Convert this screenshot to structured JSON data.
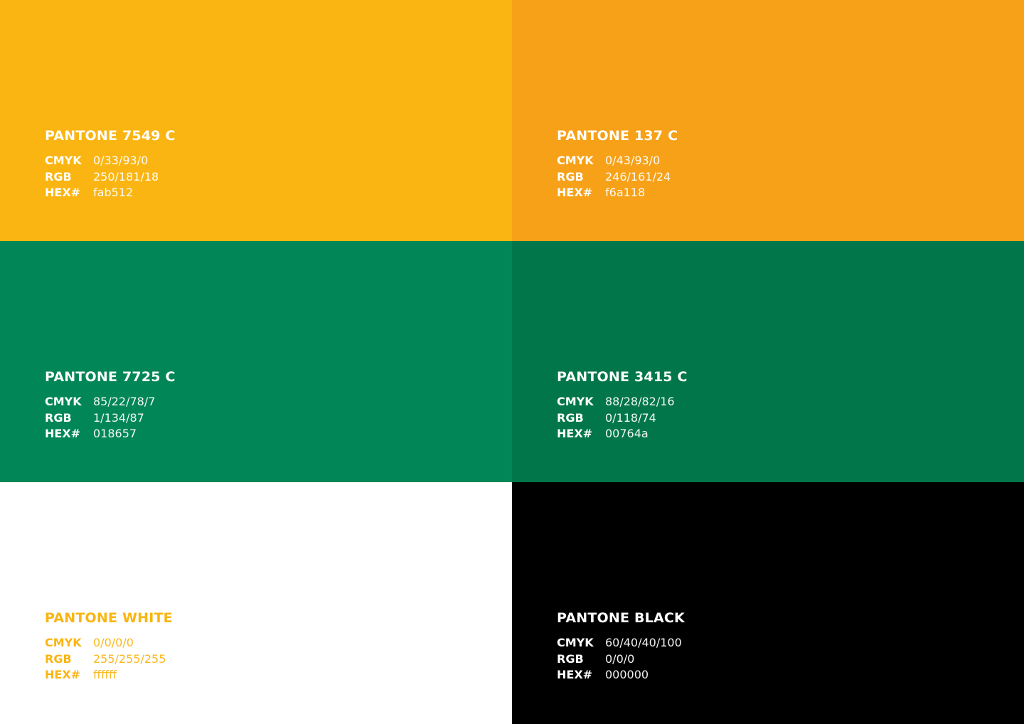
{
  "swatches": [
    {
      "name": "PANTONE 7549 C",
      "bg": "#fab512",
      "text_color": "#ffffff",
      "cmyk_label": "CMYK",
      "cmyk": "0/33/93/0",
      "rgb_label": "RGB",
      "rgb": "250/181/18",
      "hex_label": "HEX#",
      "hex": "fab512"
    },
    {
      "name": "PANTONE 137 C",
      "bg": "#f6a118",
      "text_color": "#ffffff",
      "cmyk_label": "CMYK",
      "cmyk": "0/43/93/0",
      "rgb_label": "RGB",
      "rgb": "246/161/24",
      "hex_label": "HEX#",
      "hex": "f6a118"
    },
    {
      "name": "PANTONE 7725 C",
      "bg": "#018657",
      "text_color": "#ffffff",
      "cmyk_label": "CMYK",
      "cmyk": "85/22/78/7",
      "rgb_label": "RGB",
      "rgb": "1/134/87",
      "hex_label": "HEX#",
      "hex": "018657"
    },
    {
      "name": "PANTONE 3415 C",
      "bg": "#00764a",
      "text_color": "#ffffff",
      "cmyk_label": "CMYK",
      "cmyk": "88/28/82/16",
      "rgb_label": "RGB",
      "rgb": "0/118/74",
      "hex_label": "HEX#",
      "hex": "00764a"
    },
    {
      "name": "PANTONE WHITE",
      "bg": "#ffffff",
      "text_color": "#fab512",
      "cmyk_label": "CMYK",
      "cmyk": "0/0/0/0",
      "rgb_label": "RGB",
      "rgb": "255/255/255",
      "hex_label": "HEX#",
      "hex": "ffffff"
    },
    {
      "name": "PANTONE BLACK",
      "bg": "#000000",
      "text_color": "#ffffff",
      "cmyk_label": "CMYK",
      "cmyk": "60/40/40/100",
      "rgb_label": "RGB",
      "rgb": "0/0/0",
      "hex_label": "HEX#",
      "hex": "000000"
    }
  ]
}
